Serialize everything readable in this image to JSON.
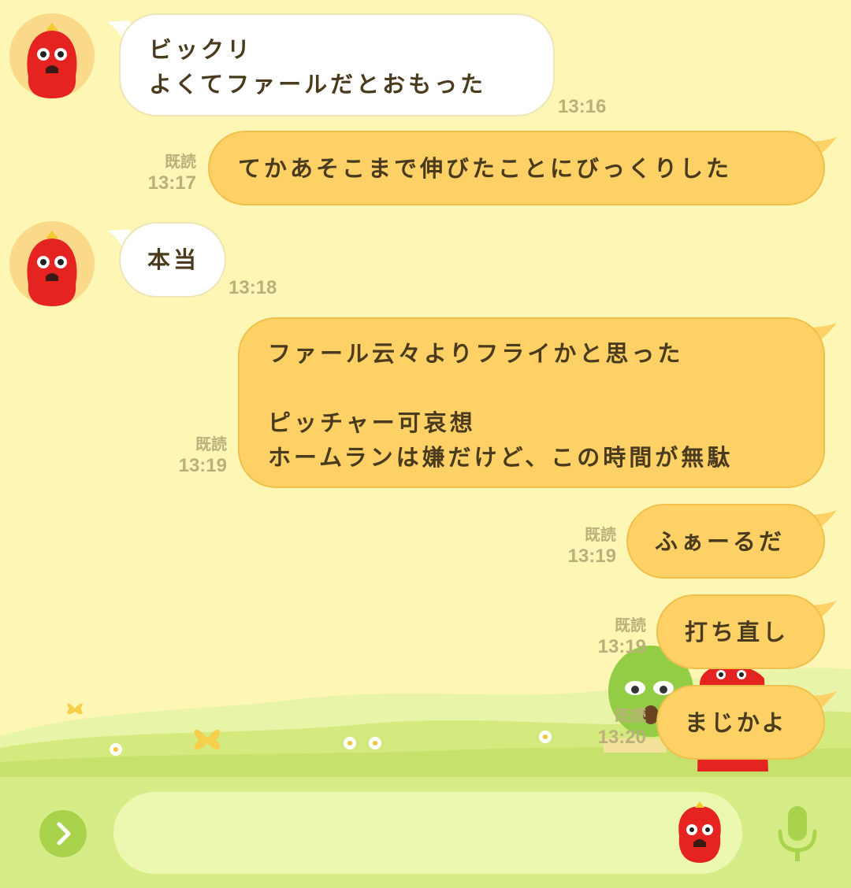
{
  "messages": [
    {
      "direction": "in",
      "lines": "ビックリ\nよくてファールだとおもった",
      "time": "13:16"
    },
    {
      "direction": "out",
      "lines": "てかあそこまで伸びたことにびっくりした",
      "read": "既読",
      "time": "13:17"
    },
    {
      "direction": "in",
      "lines": "本当",
      "time": "13:18"
    },
    {
      "direction": "out",
      "lines": "ファール云々よりフライかと思った\n\nピッチャー可哀想\nホームランは嫌だけど、この時間が無駄",
      "read": "既読",
      "time": "13:19"
    },
    {
      "direction": "out",
      "lines": "ふぁーるだ",
      "read": "既読",
      "time": "13:19"
    },
    {
      "direction": "out",
      "lines": "打ち直し",
      "read": "既読",
      "time": "13:19"
    },
    {
      "direction": "out",
      "lines": "まじかよ",
      "read": "既読",
      "time": "13:20"
    }
  ],
  "input": {
    "value": "",
    "placeholder": ""
  },
  "icons": {
    "expand": "chevron-right-icon",
    "sticker": "sticker-icon",
    "voice": "microphone-icon",
    "avatar": "red-mascot-avatar"
  },
  "colors": {
    "background": "#fdf6b4",
    "incoming_bubble": "#ffffff",
    "outgoing_bubble": "#fdd165",
    "text": "#4a3b1e",
    "meta_text": "#b9b07a",
    "input_bar": "#d6ec86",
    "input_field": "#ecf8b0",
    "accent_green": "#a9d34c"
  }
}
